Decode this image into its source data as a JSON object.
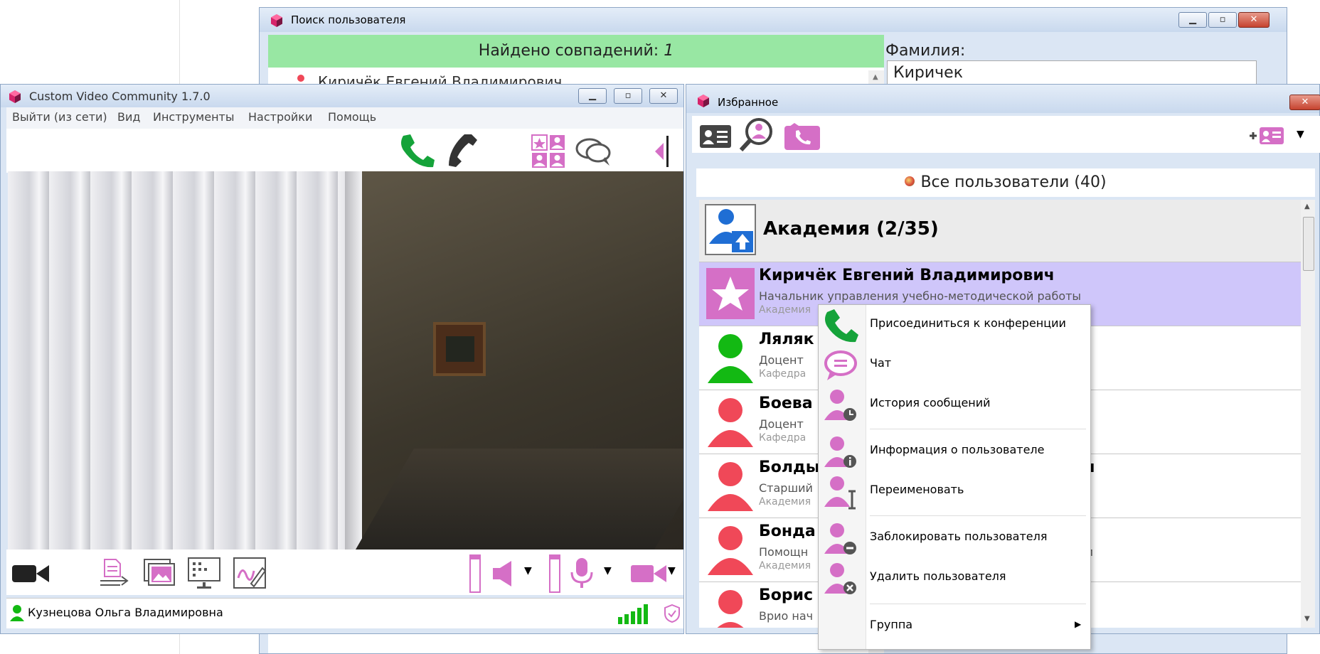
{
  "search_window": {
    "title": "Поиск пользователя",
    "matches_label": "Найдено совпадений:",
    "matches_count": "1",
    "result_name": "Киричёк Евгений Владимирович",
    "surname_label": "Фамилия:",
    "surname_value": "Киричек"
  },
  "main_window": {
    "title": "Custom Video Community 1.7.0",
    "menu": [
      "Выйти (из сети)",
      "Вид",
      "Инструменты",
      "Настройки",
      "Помощь"
    ],
    "status_user": "Кузнецова Ольга Владимировна"
  },
  "favorites_window": {
    "title": "Избранное",
    "all_users_label": "Все пользователи (40)",
    "group": {
      "label": "Академия (2/35)"
    },
    "contacts": [
      {
        "name": "Киричёк Евгений Владимирович",
        "position": "Начальник управления учебно-методической работы",
        "org": "Академия",
        "status": "favorite",
        "selected": true
      },
      {
        "name": "Ляляк",
        "position": "Доцент",
        "org": "Кафедра",
        "status": "online",
        "selected": false
      },
      {
        "name": "Боева",
        "position": "Доцент",
        "org": "Кафедра",
        "status": "offline",
        "selected": false
      },
      {
        "name": "Болды",
        "name_tail": "ч",
        "position": "Старший",
        "org": "Академия",
        "status": "offline",
        "selected": false
      },
      {
        "name": "Бонда",
        "position": "Помощн",
        "position_tail": "м",
        "org": "Академия",
        "status": "offline",
        "selected": false
      },
      {
        "name": "Борис",
        "position": "Врио нач",
        "org": "",
        "status": "offline",
        "selected": false
      }
    ]
  },
  "context_menu": {
    "items": [
      {
        "label": "Присоединиться к конференции",
        "icon": "phone-icon"
      },
      {
        "label": "Чат",
        "icon": "chat-bubble-icon"
      },
      {
        "label": "История сообщений",
        "icon": "user-clock-icon"
      },
      {
        "label": "Информация о пользователе",
        "icon": "user-info-icon"
      },
      {
        "label": "Переименовать",
        "icon": "user-rename-icon"
      },
      {
        "label": "Заблокировать пользователя",
        "icon": "user-block-icon"
      },
      {
        "label": "Удалить пользователя",
        "icon": "user-remove-icon"
      },
      {
        "label": "Группа",
        "icon": "submenu-arrow-icon"
      }
    ]
  },
  "colors": {
    "accent_pink": "#d56fc6",
    "call_green": "#15a33a",
    "online_green": "#13b913",
    "offline_red": "#f04858",
    "match_banner": "#98e7a3",
    "selected_row": "#cfc6fa",
    "window_frame": "#dbe6f4"
  }
}
